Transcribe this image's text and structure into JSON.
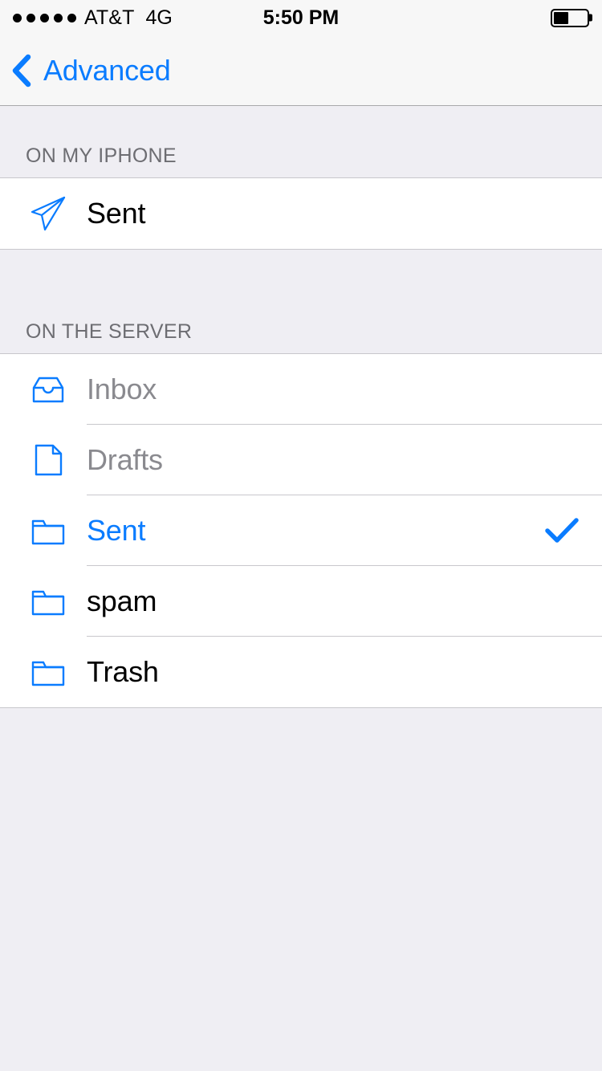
{
  "status_bar": {
    "signal_dots": 5,
    "signal_dots_total": 5,
    "carrier": "AT&T",
    "network": "4G",
    "time": "5:50 PM",
    "battery_percent": 45
  },
  "nav_bar": {
    "back_label": "Advanced",
    "back_icon": "chevron-left-icon",
    "accent_color": "#0a7cff"
  },
  "sections": [
    {
      "header": "ON MY IPHONE",
      "rows": [
        {
          "label": "Sent",
          "icon": "paper-plane-icon",
          "state": "normal",
          "checked": false
        }
      ]
    },
    {
      "header": "ON THE SERVER",
      "rows": [
        {
          "label": "Inbox",
          "icon": "inbox-tray-icon",
          "state": "disabled",
          "checked": false
        },
        {
          "label": "Drafts",
          "icon": "document-icon",
          "state": "disabled",
          "checked": false
        },
        {
          "label": "Sent",
          "icon": "folder-icon",
          "state": "selected",
          "checked": true
        },
        {
          "label": "spam",
          "icon": "folder-icon",
          "state": "normal",
          "checked": false
        },
        {
          "label": "Trash",
          "icon": "folder-icon",
          "state": "normal",
          "checked": false
        }
      ]
    }
  ],
  "colors": {
    "accent": "#0a7cff",
    "group_background": "#efeef3",
    "row_background": "#ffffff",
    "separator": "#c8c7cc",
    "header_text": "#6d6d72",
    "disabled_text": "#8a8a8f"
  }
}
